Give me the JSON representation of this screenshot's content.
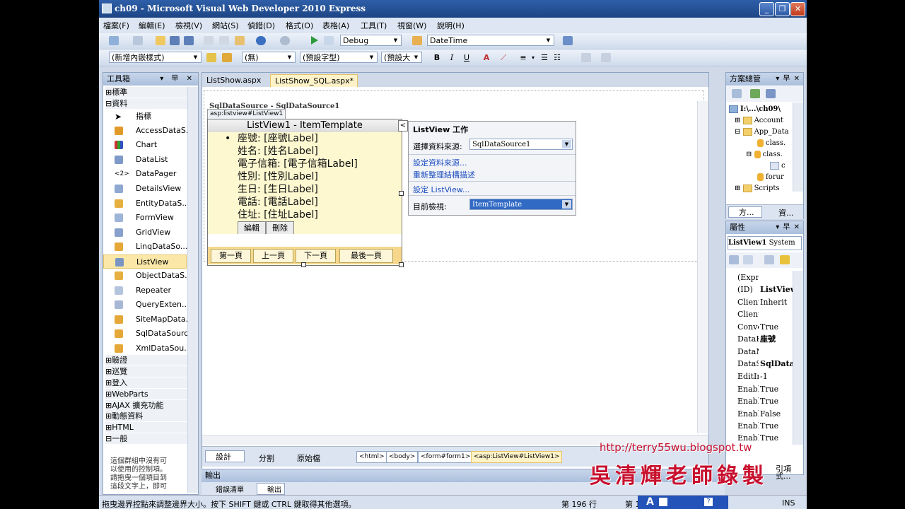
{
  "window": {
    "title": "ch09 - Microsoft Visual Web Developer 2010 Express",
    "minimize": "_",
    "maximize": "❐",
    "close": "✕"
  },
  "menu": [
    "檔案(F)",
    "編輯(E)",
    "檢視(V)",
    "網站(S)",
    "偵錯(D)",
    "格式(O)",
    "表格(A)",
    "工具(T)",
    "視窗(W)",
    "說明(H)"
  ],
  "toolbar1": {
    "config": "Debug",
    "find": "DateTime"
  },
  "toolbar2": {
    "style": "(新增內嵌樣式)",
    "block": "(無)",
    "font": "(預設字型)",
    "size": "(預設大",
    "bold": "B",
    "italic": "I",
    "underline": "U",
    "more": "▾"
  },
  "toolbox": {
    "title": "工具箱",
    "pin": "▾ 早 ✕",
    "groups_top": [
      {
        "label": "⊞標準"
      },
      {
        "label": "⊟資料"
      }
    ],
    "items": [
      "指標",
      "AccessDataS...",
      "Chart",
      "DataList",
      "DataPager",
      "DetailsView",
      "EntityDataS...",
      "FormView",
      "GridView",
      "LinqDataSo...",
      "ListView",
      "ObjectDataS...",
      "Repeater",
      "QueryExten...",
      "SiteMapData...",
      "SqlDataSource",
      "XmlDataSou..."
    ],
    "groups_bottom": [
      "⊞驗證",
      "⊞巡覽",
      "⊞登入",
      "⊞WebParts",
      "⊞AJAX 擴充功能",
      "⊞動態資料",
      "⊞HTML",
      "⊟一般"
    ],
    "empty_text": [
      "這個群組中沒有可",
      "以使用的控制項。",
      "請拖曳一個項目到",
      "這段文字上，即可"
    ]
  },
  "tabs": [
    {
      "label": "ListShow.aspx"
    },
    {
      "label": "ListShow_SQL.aspx*"
    }
  ],
  "tab_close": "✕",
  "designer": {
    "sqlsource_label": "SqlDataSource - SqlDataSource1",
    "listview_tag": "asp:listview#ListView1",
    "listview_header": "ListView1 - ItemTemplate",
    "bullet": "•",
    "fields": [
      "座號: [座號Label]",
      "姓名: [姓名Label]",
      "電子信箱: [電子信箱Label]",
      "性別: [性別Label]",
      "生日: [生日Label]",
      "電話: [電話Label]",
      "住址: [住址Label]"
    ],
    "edit": "編輯",
    "delete": "刪除",
    "pager": [
      "第一頁",
      "上一頁",
      "下一頁",
      "最後一頁"
    ],
    "smart_arrow": "<"
  },
  "tasks": {
    "title": "ListView 工作",
    "source_label": "選擇資料來源:",
    "source_value": "SqlDataSource1",
    "config_source": "設定資料來源...",
    "refresh_schema": "重新整理結構描述",
    "config_listview": "設定 ListView...",
    "view_label": "目前檢視:",
    "view_value": "ItemTemplate"
  },
  "viewbar": {
    "design": "設計",
    "split": "分割",
    "source": "原始檔",
    "crumbs": [
      "<html>",
      "<body>",
      "<form#form1>",
      "<asp:ListView#ListView1>"
    ]
  },
  "output": {
    "title": "輸出",
    "tabs": [
      "錯誤清單",
      "輸出"
    ]
  },
  "solution": {
    "title": "方案總管",
    "pin": "▾ 早 ✕",
    "tree": [
      {
        "label": "I:\\...\\ch09\\",
        "indent": 0
      },
      {
        "label": "Account",
        "indent": 1
      },
      {
        "label": "App_Data",
        "indent": 1
      },
      {
        "label": "class.",
        "indent": 2
      },
      {
        "label": "class.",
        "indent": 2
      },
      {
        "label": "c",
        "indent": 3
      },
      {
        "label": "forur",
        "indent": 2
      },
      {
        "label": "Scripts",
        "indent": 1
      }
    ],
    "tab1": "方...",
    "tab2": "資..."
  },
  "properties": {
    "title": "屬性",
    "pin": "▾ 早 ✕",
    "object": "ListView1",
    "object_type": "System",
    "rows": [
      {
        "k": "(Expr",
        "v": ""
      },
      {
        "k": "(ID)",
        "v": "ListView"
      },
      {
        "k": "Client",
        "v": "Inherit"
      },
      {
        "k": "Client",
        "v": ""
      },
      {
        "k": "Conve",
        "v": "True"
      },
      {
        "k": "DataK",
        "v": "座號"
      },
      {
        "k": "DataM",
        "v": ""
      },
      {
        "k": "DataS",
        "v": "SqlData"
      },
      {
        "k": "EditIn",
        "v": "-1"
      },
      {
        "k": "Enabl",
        "v": "True"
      },
      {
        "k": "Enabl",
        "v": "True"
      },
      {
        "k": "Enabl",
        "v": "False"
      },
      {
        "k": "Enabl",
        "v": "True"
      },
      {
        "k": "Enabl",
        "v": "True"
      }
    ],
    "footer": [
      "引項",
      "式..."
    ]
  },
  "statusbar": {
    "hint": "拖曳邊界控點來調整邊界大小。按下 SHIFT 鍵或 CTRL 鍵取得其他選項。",
    "line": "第 196 行",
    "col": "第 1",
    "ins": "INS"
  },
  "watermark": {
    "url": "http://terry55wu.blogspot.tw",
    "text": "吳清輝老師錄製"
  },
  "colors": {
    "accent": "#2d5aa6",
    "selection": "#316ac5",
    "template_bg": "#fdf8d0",
    "watermark_red": "#c8102e"
  }
}
